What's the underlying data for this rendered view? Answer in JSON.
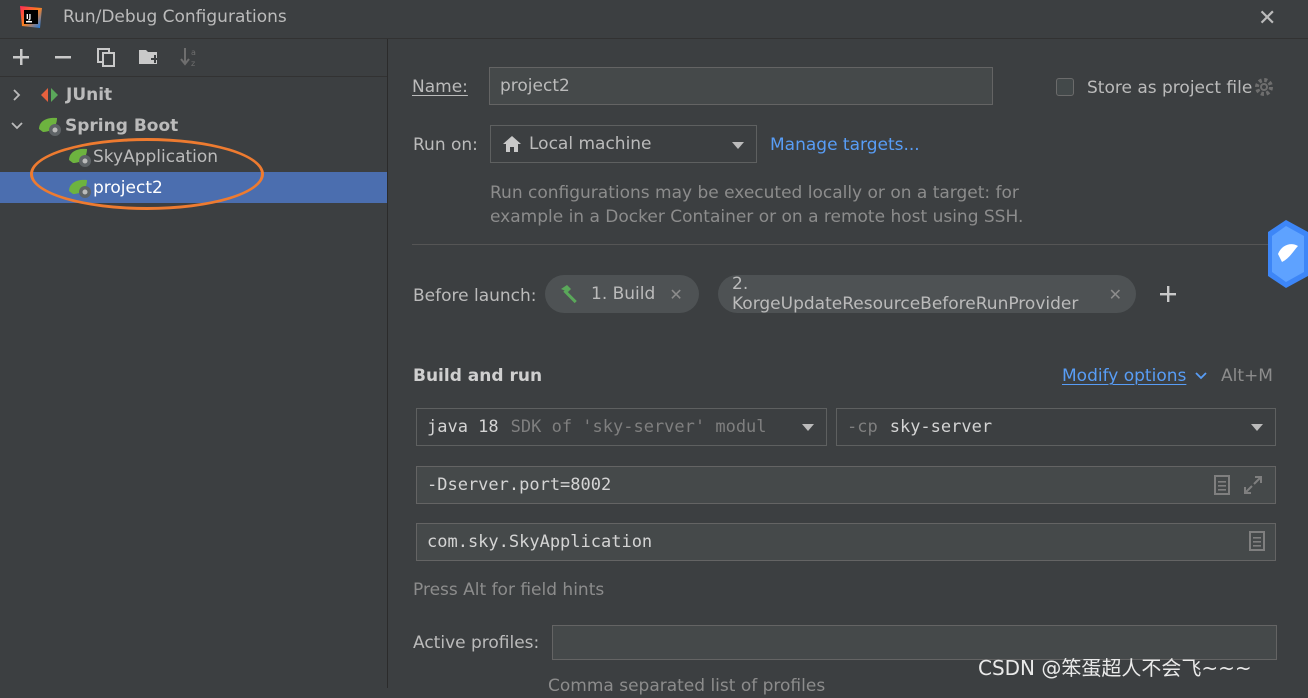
{
  "window": {
    "title": "Run/Debug Configurations",
    "close_icon": "close-icon"
  },
  "toolbar": {
    "icons": [
      "add-icon",
      "remove-icon",
      "copy-icon",
      "folder-add-icon",
      "sort-icon"
    ]
  },
  "tree": {
    "groups": [
      {
        "label": "JUnit",
        "expanded": false
      },
      {
        "label": "Spring Boot",
        "expanded": true,
        "children": [
          {
            "label": "SkyApplication",
            "selected": false
          },
          {
            "label": "project2",
            "selected": true
          }
        ]
      }
    ]
  },
  "form": {
    "name_label": "Name:",
    "name_value": "project2",
    "store_label": "Store as project file",
    "run_on_label": "Run on:",
    "run_on_value": "Local machine",
    "manage_targets": "Manage targets...",
    "run_hint_line1": "Run configurations may be executed locally or on a target: for",
    "run_hint_line2": "example in a Docker Container or on a remote host using SSH.",
    "before_launch_label": "Before launch:",
    "before_launch_items": [
      "1. Build",
      "2. KorgeUpdateResourceBeforeRunProvider"
    ],
    "build_run_label": "Build and run",
    "modify_options": "Modify options",
    "modify_shortcut": "Alt+M",
    "jdk_main": "java 18",
    "jdk_sub": "SDK of 'sky-server' modul",
    "cp_prefix": "-cp",
    "cp_value": "sky-server",
    "vm_options": "-Dserver.port=8002",
    "main_class": "com.sky.SkyApplication",
    "field_hint": "Press Alt for field hints",
    "active_profiles_label": "Active profiles:",
    "active_profiles_value": "",
    "profiles_hint": "Comma separated list of profiles"
  },
  "watermark": "CSDN @笨蛋超人不会飞~~~",
  "colors": {
    "selection": "#4b6eaf",
    "link": "#589df6",
    "annotation": "#ee7b30"
  }
}
